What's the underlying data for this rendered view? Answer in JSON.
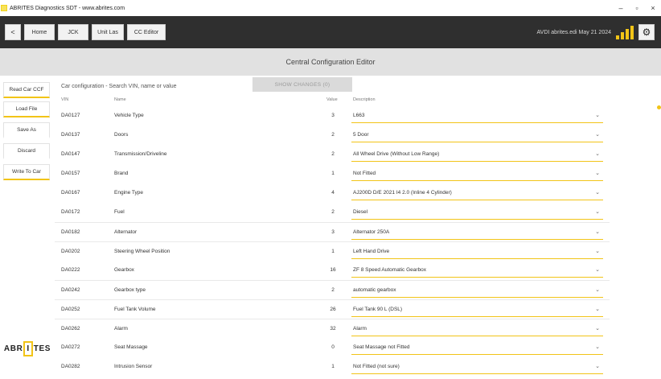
{
  "window": {
    "title": "ABRITES Diagnostics SDT - www.abrites.com",
    "buttons": {
      "minimize": "–",
      "maximize": "▫",
      "close": "×"
    }
  },
  "toolbar": {
    "back": "<",
    "home": "Home",
    "jck": "JCK",
    "unitlas": "Unit Las",
    "cc_editor": "CC Editor",
    "user_info": "AVDI abrites.edi May 21 2024",
    "gear": "⚙",
    "signal_color": "#f2c417"
  },
  "header": {
    "title": "Central Configuration Editor"
  },
  "sidebar": {
    "buttons": [
      {
        "label": "Read Car CCF"
      },
      {
        "label": "Load File"
      },
      {
        "label": "Save As"
      },
      {
        "label": "Discard"
      },
      {
        "label": "Write To Car"
      }
    ],
    "logo": [
      "A",
      "B",
      "R",
      "I",
      "T",
      "E",
      "S"
    ]
  },
  "main": {
    "search_text": "Car configuration - Search VIN, name or value",
    "show_changes": "SHOW CHANGES (0)",
    "columns": {
      "vin": "VIN",
      "name": "Name",
      "value": "Value",
      "description": "Description"
    },
    "rows": [
      {
        "vin": "DA0127",
        "name": "Vehicle Type",
        "value": "3",
        "selection": "L663"
      },
      {
        "vin": "DA0137",
        "name": "Doors",
        "value": "2",
        "selection": "5 Door"
      },
      {
        "vin": "DA0147",
        "name": "Transmission/Driveline",
        "value": "2",
        "selection": "All Wheel Drive (Without Low Range)"
      },
      {
        "vin": "DA0157",
        "name": "Brand",
        "value": "1",
        "selection": "Not Fitted"
      },
      {
        "vin": "DA0167",
        "name": "Engine Type",
        "value": "4",
        "selection": "AJ200D D/E 2021 I4 2.0 (Inline 4 Cylinder)"
      },
      {
        "vin": "DA0172",
        "name": "Fuel",
        "value": "2",
        "selection": "Diesel"
      },
      {
        "vin": "DA0182",
        "name": "Alternator",
        "value": "3",
        "selection": "Alternator 250A"
      },
      {
        "vin": "DA0202",
        "name": "Steering Wheel Position",
        "value": "1",
        "selection": "Left Hand Drive"
      },
      {
        "vin": "DA0222",
        "name": "Gearbox",
        "value": "16",
        "selection": "ZF 8 Speed Automatic Gearbox"
      },
      {
        "vin": "DA0242",
        "name": "Gearbox type",
        "value": "2",
        "selection": "automatic gearbox"
      },
      {
        "vin": "DA0252",
        "name": "Fuel Tank Volume",
        "value": "26",
        "selection": "Fuel Tank 90 L (DSL)"
      },
      {
        "vin": "DA0262",
        "name": "Alarm",
        "value": "32",
        "selection": "Alarm"
      },
      {
        "vin": "DA0272",
        "name": "Seat Massage",
        "value": "0",
        "selection": "Seat Massage not Fitted"
      },
      {
        "vin": "DA0282",
        "name": "Intrusion Sensor",
        "value": "1",
        "selection": "Not Fitted (not sure)"
      }
    ]
  },
  "colors": {
    "accent": "#f2c417",
    "toolbar": "#2f2f2f",
    "header": "#e1e1e1"
  }
}
